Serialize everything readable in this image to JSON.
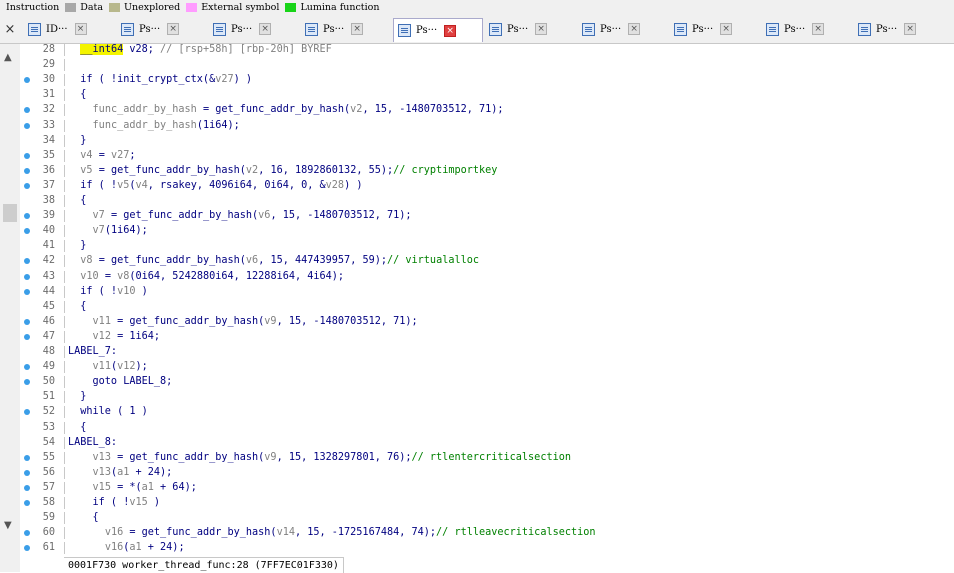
{
  "legend": [
    {
      "label": "Instruction",
      "color": ""
    },
    {
      "label": "Data",
      "color": "#a8a8a8"
    },
    {
      "label": "Unexplored",
      "color": "#b8b88c"
    },
    {
      "label": "External symbol",
      "color": "#ff9cff"
    },
    {
      "label": "Lumina function",
      "color": "#18d418"
    }
  ],
  "tabs": [
    {
      "label": "ID···",
      "active": false
    },
    {
      "label": "Ps···",
      "active": false
    },
    {
      "label": "Ps···",
      "active": false
    },
    {
      "label": "Ps···",
      "active": false
    },
    {
      "label": "Ps···",
      "active": true
    },
    {
      "label": "Ps···",
      "active": false
    },
    {
      "label": "Ps···",
      "active": false
    },
    {
      "label": "Ps···",
      "active": false
    },
    {
      "label": "Ps···",
      "active": false
    },
    {
      "label": "Ps···",
      "active": false
    }
  ],
  "tabbar_close_glyph": "×",
  "lines": [
    {
      "num": "28",
      "dot": false,
      "parts": [
        [
          "  ",
          ""
        ],
        [
          "__int64",
          "type"
        ],
        [
          " v28; ",
          ""
        ],
        [
          "// [rsp+58h] [rbp-20h] BYREF",
          "cmt"
        ]
      ]
    },
    {
      "num": "29",
      "dot": false,
      "parts": []
    },
    {
      "num": "30",
      "dot": true,
      "parts": [
        [
          "  if ( !init_crypt_ctx(&",
          ""
        ],
        [
          "v27",
          "var"
        ],
        [
          ") )",
          ""
        ]
      ]
    },
    {
      "num": "31",
      "dot": false,
      "parts": [
        [
          "  {",
          ""
        ]
      ]
    },
    {
      "num": "32",
      "dot": true,
      "parts": [
        [
          "    ",
          ""
        ],
        [
          "func_addr_by_hash",
          "var"
        ],
        [
          " = get_func_addr_by_hash(",
          ""
        ],
        [
          "v2",
          "var"
        ],
        [
          ", 15, -1480703512, 71);",
          ""
        ]
      ]
    },
    {
      "num": "33",
      "dot": true,
      "parts": [
        [
          "    ",
          ""
        ],
        [
          "func_addr_by_hash",
          "var"
        ],
        [
          "(1i64);",
          ""
        ]
      ]
    },
    {
      "num": "34",
      "dot": false,
      "parts": [
        [
          "  }",
          ""
        ]
      ]
    },
    {
      "num": "35",
      "dot": true,
      "parts": [
        [
          "  ",
          ""
        ],
        [
          "v4",
          "var"
        ],
        [
          " = ",
          ""
        ],
        [
          "v27",
          "var"
        ],
        [
          ";",
          ""
        ]
      ]
    },
    {
      "num": "36",
      "dot": true,
      "parts": [
        [
          "  ",
          ""
        ],
        [
          "v5",
          "var"
        ],
        [
          " = get_func_addr_by_hash(",
          ""
        ],
        [
          "v2",
          "var"
        ],
        [
          ", 16, 1892860132, 55);",
          ""
        ],
        [
          "// cryptimportkey",
          "gcmt"
        ]
      ]
    },
    {
      "num": "37",
      "dot": true,
      "parts": [
        [
          "  if ( !",
          ""
        ],
        [
          "v5",
          "var"
        ],
        [
          "(",
          ""
        ],
        [
          "v4",
          "var"
        ],
        [
          ", rsakey, 4096i64, 0i64, 0, &",
          ""
        ],
        [
          "v28",
          "var"
        ],
        [
          ") )",
          ""
        ]
      ]
    },
    {
      "num": "38",
      "dot": false,
      "parts": [
        [
          "  {",
          ""
        ]
      ]
    },
    {
      "num": "39",
      "dot": true,
      "parts": [
        [
          "    ",
          ""
        ],
        [
          "v7",
          "var"
        ],
        [
          " = get_func_addr_by_hash(",
          ""
        ],
        [
          "v6",
          "var"
        ],
        [
          ", 15, -1480703512, 71);",
          ""
        ]
      ]
    },
    {
      "num": "40",
      "dot": true,
      "parts": [
        [
          "    ",
          ""
        ],
        [
          "v7",
          "var"
        ],
        [
          "(1i64);",
          ""
        ]
      ]
    },
    {
      "num": "41",
      "dot": false,
      "parts": [
        [
          "  }",
          ""
        ]
      ]
    },
    {
      "num": "42",
      "dot": true,
      "parts": [
        [
          "  ",
          ""
        ],
        [
          "v8",
          "var"
        ],
        [
          " = get_func_addr_by_hash(",
          ""
        ],
        [
          "v6",
          "var"
        ],
        [
          ", 15, 447439957, 59);",
          ""
        ],
        [
          "// virtualalloc",
          "gcmt"
        ]
      ]
    },
    {
      "num": "43",
      "dot": true,
      "parts": [
        [
          "  ",
          ""
        ],
        [
          "v10",
          "var"
        ],
        [
          " = ",
          ""
        ],
        [
          "v8",
          "var"
        ],
        [
          "(0i64, 5242880i64, 12288i64, 4i64);",
          ""
        ]
      ]
    },
    {
      "num": "44",
      "dot": true,
      "parts": [
        [
          "  if ( !",
          ""
        ],
        [
          "v10",
          "var"
        ],
        [
          " )",
          ""
        ]
      ]
    },
    {
      "num": "45",
      "dot": false,
      "parts": [
        [
          "  {",
          ""
        ]
      ]
    },
    {
      "num": "46",
      "dot": true,
      "parts": [
        [
          "    ",
          ""
        ],
        [
          "v11",
          "var"
        ],
        [
          " = get_func_addr_by_hash(",
          ""
        ],
        [
          "v9",
          "var"
        ],
        [
          ", 15, -1480703512, 71);",
          ""
        ]
      ]
    },
    {
      "num": "47",
      "dot": true,
      "parts": [
        [
          "    ",
          ""
        ],
        [
          "v12",
          "var"
        ],
        [
          " = 1i64;",
          ""
        ]
      ]
    },
    {
      "num": "48",
      "dot": false,
      "parts": [
        [
          "LABEL_7:",
          ""
        ]
      ]
    },
    {
      "num": "49",
      "dot": true,
      "parts": [
        [
          "    ",
          ""
        ],
        [
          "v11",
          "var"
        ],
        [
          "(",
          ""
        ],
        [
          "v12",
          "var"
        ],
        [
          ");",
          ""
        ]
      ]
    },
    {
      "num": "50",
      "dot": true,
      "parts": [
        [
          "    goto LABEL_8;",
          ""
        ]
      ]
    },
    {
      "num": "51",
      "dot": false,
      "parts": [
        [
          "  }",
          ""
        ]
      ]
    },
    {
      "num": "52",
      "dot": true,
      "parts": [
        [
          "  while ( 1 )",
          ""
        ]
      ]
    },
    {
      "num": "53",
      "dot": false,
      "parts": [
        [
          "  {",
          ""
        ]
      ]
    },
    {
      "num": "54",
      "dot": false,
      "parts": [
        [
          "LABEL_8:",
          ""
        ]
      ]
    },
    {
      "num": "55",
      "dot": true,
      "parts": [
        [
          "    ",
          ""
        ],
        [
          "v13",
          "var"
        ],
        [
          " = get_func_addr_by_hash(",
          ""
        ],
        [
          "v9",
          "var"
        ],
        [
          ", 15, 1328297801, 76);",
          ""
        ],
        [
          "// rtlentercriticalsection",
          "gcmt"
        ]
      ]
    },
    {
      "num": "56",
      "dot": true,
      "parts": [
        [
          "    ",
          ""
        ],
        [
          "v13",
          "var"
        ],
        [
          "(",
          ""
        ],
        [
          "a1",
          "var"
        ],
        [
          " + 24);",
          ""
        ]
      ]
    },
    {
      "num": "57",
      "dot": true,
      "parts": [
        [
          "    ",
          ""
        ],
        [
          "v15",
          "var"
        ],
        [
          " = *(",
          ""
        ],
        [
          "a1",
          "var"
        ],
        [
          " + 64);",
          ""
        ]
      ]
    },
    {
      "num": "58",
      "dot": true,
      "parts": [
        [
          "    if ( !",
          ""
        ],
        [
          "v15",
          "var"
        ],
        [
          " )",
          ""
        ]
      ]
    },
    {
      "num": "59",
      "dot": false,
      "parts": [
        [
          "    {",
          ""
        ]
      ]
    },
    {
      "num": "60",
      "dot": true,
      "parts": [
        [
          "      ",
          ""
        ],
        [
          "v16",
          "var"
        ],
        [
          " = get_func_addr_by_hash(",
          ""
        ],
        [
          "v14",
          "var"
        ],
        [
          ", 15, -1725167484, 74);",
          ""
        ],
        [
          "// rtlleavecriticalsection",
          "gcmt"
        ]
      ]
    },
    {
      "num": "61",
      "dot": true,
      "parts": [
        [
          "      ",
          ""
        ],
        [
          "v16",
          "var"
        ],
        [
          "(",
          ""
        ],
        [
          "a1",
          "var"
        ],
        [
          " + 24);",
          ""
        ]
      ]
    }
  ],
  "status": "0001F730 worker_thread_func:28 (7FF7EC01F330)"
}
